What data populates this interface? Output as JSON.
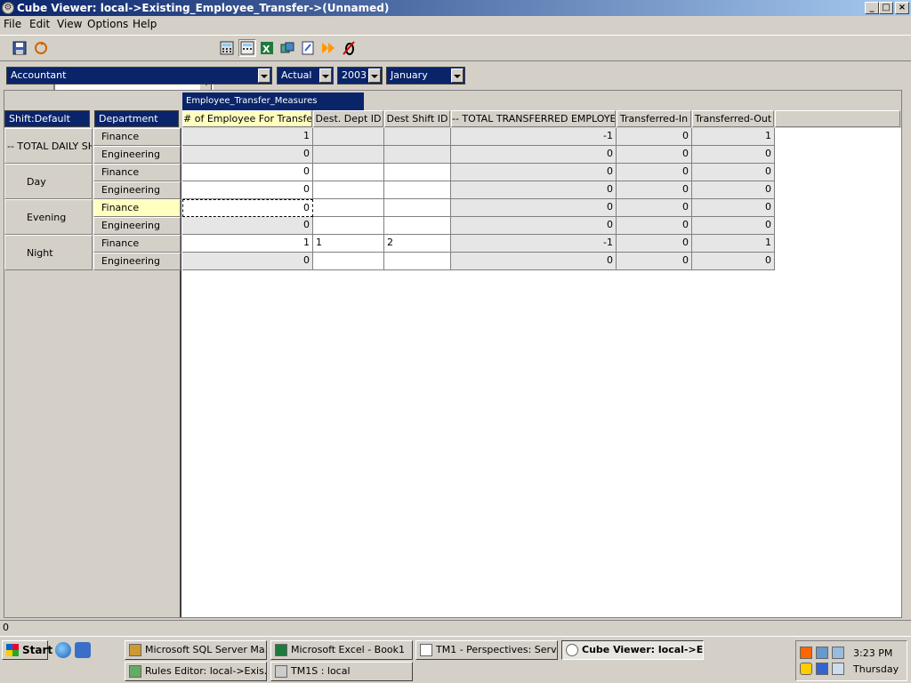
{
  "window": {
    "title": "Cube Viewer: local->Existing_Employee_Transfer->(Unnamed)",
    "controls": {
      "minimize": "_",
      "maximize": "□",
      "close": "×"
    }
  },
  "menu": {
    "items": [
      {
        "label": "File"
      },
      {
        "label": "Edit"
      },
      {
        "label": "View"
      },
      {
        "label": "Options"
      },
      {
        "label": "Help"
      }
    ]
  },
  "toolbar": {
    "view_combo_value": "",
    "icons": [
      "save-view-icon",
      "recalculate-icon",
      "calculator-icon",
      "automatic-recalc-icon",
      "excel-icon",
      "cube-icon",
      "sandbox-icon",
      "forward-icon",
      "zero-suppress-icon"
    ]
  },
  "dimension_selectors": [
    {
      "value": "Accountant"
    },
    {
      "value": "Actual"
    },
    {
      "value": "2003"
    },
    {
      "value": "January"
    }
  ],
  "grid": {
    "measure_dimension": "Employee_Transfer_Measures",
    "row_dimensions": [
      "Shift:Default",
      "Department"
    ],
    "columns": [
      "# of Employee For Transfer",
      "Dest. Dept ID",
      "Dest Shift ID",
      "-- TOTAL TRANSFERRED EMPLOYEES",
      "Transferred-In",
      "Transferred-Out"
    ],
    "shift_groups": [
      {
        "label": "-- TOTAL DAILY SHI"
      },
      {
        "label": "Day"
      },
      {
        "label": "Evening"
      },
      {
        "label": "Night"
      }
    ],
    "rows": [
      {
        "dept": "Finance",
        "values": [
          "1",
          "",
          "",
          "-1",
          "0",
          "1"
        ]
      },
      {
        "dept": "Engineering",
        "values": [
          "0",
          "",
          "",
          "0",
          "0",
          "0"
        ]
      },
      {
        "dept": "Finance",
        "values": [
          "0",
          "",
          "",
          "0",
          "0",
          "0"
        ]
      },
      {
        "dept": "Engineering",
        "values": [
          "0",
          "",
          "",
          "0",
          "0",
          "0"
        ]
      },
      {
        "dept": "Finance",
        "values": [
          "0",
          "",
          "",
          "0",
          "0",
          "0"
        ]
      },
      {
        "dept": "Engineering",
        "values": [
          "0",
          "",
          "",
          "0",
          "0",
          "0"
        ]
      },
      {
        "dept": "Finance",
        "values": [
          "1",
          "1",
          "2",
          "-1",
          "0",
          "1"
        ]
      },
      {
        "dept": "Engineering",
        "values": [
          "0",
          "",
          "",
          "0",
          "0",
          "0"
        ]
      }
    ]
  },
  "status": {
    "text": "0"
  },
  "taskbar": {
    "start_label": "Start",
    "buttons": [
      {
        "label": "Microsoft SQL Server Ma...",
        "icon": "sql-server-icon"
      },
      {
        "label": "Microsoft Excel - Book1",
        "icon": "excel-icon"
      },
      {
        "label": "TM1 - Perspectives: Serv...",
        "icon": "tm1-icon"
      },
      {
        "label": "Cube Viewer: local->E...",
        "icon": "cube-viewer-icon"
      },
      {
        "label": "Rules Editor:  local->Exis...",
        "icon": "rules-editor-icon"
      },
      {
        "label": "TM1S : local",
        "icon": "tm1s-icon"
      }
    ],
    "clock_time": "3:23 PM",
    "clock_day": "Thursday"
  }
}
